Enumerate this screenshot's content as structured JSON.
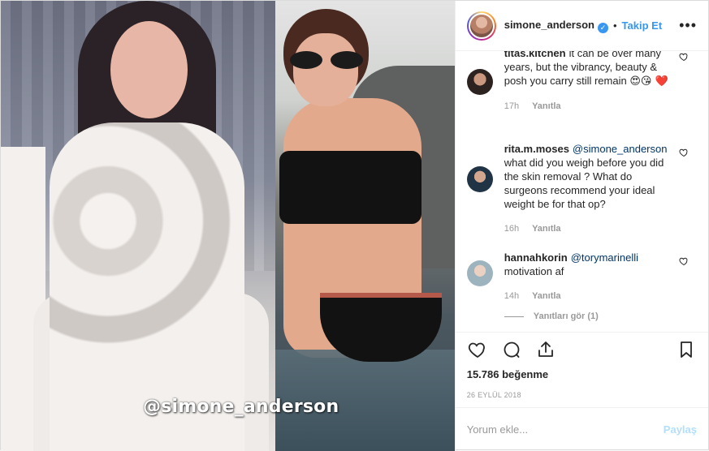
{
  "header": {
    "username": "simone_anderson",
    "verified_icon": "check-icon",
    "follow_label": "Takip Et",
    "more_icon": "ellipsis-icon"
  },
  "media": {
    "watermark": "@simone_anderson"
  },
  "comments": [
    {
      "user": "titas.kitchen",
      "text": "it can be over many years, but the vibrancy, beauty & posh you carry still remain",
      "emoji": "😍😘 ❤️",
      "time": "17h",
      "reply_label": "Yanıtla"
    },
    {
      "user": "rita.m.moses",
      "mention": "@simone_anderson",
      "text": "what did you weigh before you did the skin removal ? What do surgeons recommend your ideal weight be for that op?",
      "time": "16h",
      "reply_label": "Yanıtla"
    },
    {
      "user": "hannahkorin",
      "mention": "@torymarinelli",
      "text": "motivation af",
      "time": "14h",
      "reply_label": "Yanıtla"
    }
  ],
  "view_replies_label": "Yanıtları gör (1)",
  "likes_label": "15.786 beğenme",
  "date_label": "26 EYLÜL 2018",
  "add_comment": {
    "placeholder": "Yorum ekle...",
    "post_label": "Paylaş"
  },
  "colors": {
    "accent": "#3897f0",
    "post_disabled": "#b2dffc"
  }
}
